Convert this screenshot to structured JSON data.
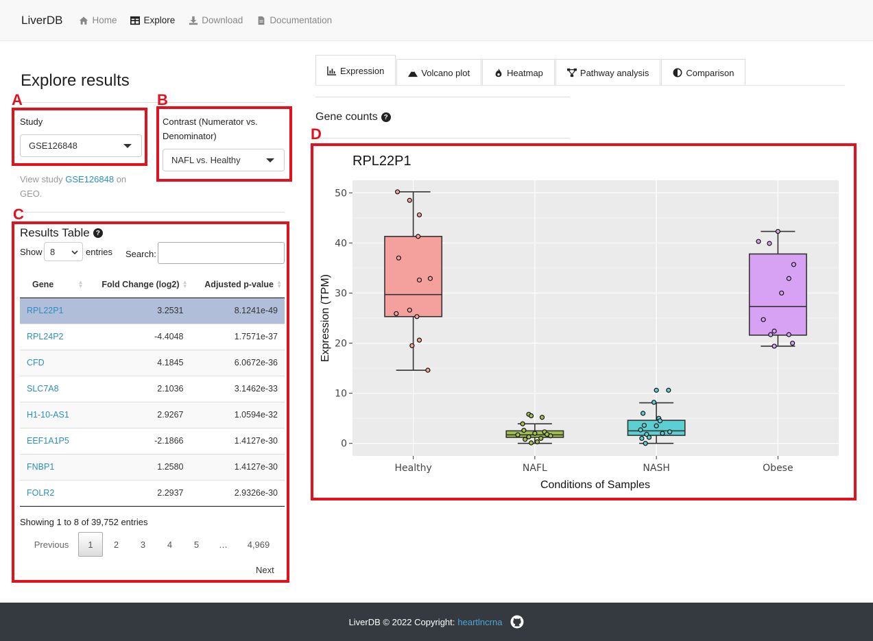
{
  "navbar": {
    "brand": "LiverDB",
    "items": [
      {
        "label": "Home",
        "icon": "home-icon"
      },
      {
        "label": "Explore",
        "icon": "table-icon"
      },
      {
        "label": "Download",
        "icon": "download-icon"
      },
      {
        "label": "Documentation",
        "icon": "file-icon"
      }
    ]
  },
  "annotations": [
    "A",
    "B",
    "C",
    "D"
  ],
  "sidebar": {
    "title": "Explore results",
    "study_label": "Study",
    "study_value": "GSE126848",
    "contrast_label": "Contrast (Numerator vs. Denominator)",
    "contrast_value": "NAFL vs. Healthy",
    "view_prefix": "View study ",
    "view_link": "GSE126848",
    "view_suffix": " on GEO."
  },
  "results": {
    "title": "Results Table",
    "show_label": "Show",
    "show_value": "8",
    "entries_label": "entries",
    "search_label": "Search:",
    "search_value": "",
    "columns": [
      "Gene",
      "Fold Change (log2)",
      "Adjusted p-value"
    ],
    "rows": [
      [
        "RPL22P1",
        "3.2531",
        "8.1241e-49"
      ],
      [
        "RPL24P2",
        "-4.4048",
        "1.7571e-37"
      ],
      [
        "CFD",
        "4.1845",
        "6.0672e-36"
      ],
      [
        "SLC7A8",
        "2.1036",
        "3.1462e-33"
      ],
      [
        "H1-10-AS1",
        "2.9267",
        "1.0594e-32"
      ],
      [
        "EEF1A1P5",
        "-2.1866",
        "1.4127e-30"
      ],
      [
        "FNBP1",
        "1.2580",
        "1.4127e-30"
      ],
      [
        "FOLR2",
        "2.2937",
        "2.9326e-30"
      ]
    ],
    "info": "Showing 1 to 8 of 39,752 entries",
    "pagination": [
      "Previous",
      "1",
      "2",
      "3",
      "4",
      "5",
      "…",
      "4,969"
    ],
    "next": "Next"
  },
  "tabs": [
    {
      "label": "Expression",
      "icon": "bar-chart-icon"
    },
    {
      "label": "Volcano plot",
      "icon": "mountain-icon"
    },
    {
      "label": "Heatmap",
      "icon": "fire-icon"
    },
    {
      "label": "Pathway analysis",
      "icon": "network-icon"
    },
    {
      "label": "Comparison",
      "icon": "half-circle-icon"
    }
  ],
  "gene_counts_title": "Gene counts",
  "chart_data": {
    "type": "box",
    "title": "RPL22P1",
    "xlabel": "Conditions of Samples",
    "ylabel": "Expression (TPM)",
    "ylim": [
      -2.5,
      52.5
    ],
    "yticks": [
      0,
      10,
      20,
      30,
      40,
      50
    ],
    "grid": true,
    "categories": [
      "Healthy",
      "NAFL",
      "NASH",
      "Obese"
    ],
    "colors": [
      "#f4a09c",
      "#a3c247",
      "#5ccfd2",
      "#d7a2f3"
    ],
    "boxes": [
      {
        "q1": 25.3,
        "median": 29.7,
        "q3": 41.3,
        "whisker_low": 14.6,
        "whisker_high": 50.2
      },
      {
        "q1": 1.2,
        "median": 1.7,
        "q3": 2.5,
        "whisker_low": 0.0,
        "whisker_high": 3.9
      },
      {
        "q1": 1.6,
        "median": 2.5,
        "q3": 4.6,
        "whisker_low": 0.0,
        "whisker_high": 8.1
      },
      {
        "q1": 21.6,
        "median": 27.3,
        "q3": 37.8,
        "whisker_low": 19.4,
        "whisker_high": 42.3
      }
    ],
    "points": [
      [
        [
          -0.13,
          50.2
        ],
        [
          -0.03,
          48.5
        ],
        [
          0.05,
          45.6
        ],
        [
          0.04,
          41.3
        ],
        [
          -0.12,
          37.0
        ],
        [
          0.14,
          32.9
        ],
        [
          0.05,
          32.6
        ],
        [
          -0.03,
          26.6
        ],
        [
          -0.14,
          25.9
        ],
        [
          0.03,
          25.3
        ],
        [
          0.05,
          20.6
        ],
        [
          -0.01,
          19.5
        ],
        [
          0.12,
          14.6
        ]
      ],
      [
        [
          -0.05,
          5.8
        ],
        [
          -0.03,
          5.5
        ],
        [
          0.06,
          5.2
        ],
        [
          -0.1,
          3.9
        ],
        [
          0.08,
          2.3
        ],
        [
          -0.09,
          2.6
        ],
        [
          -0.14,
          1.7
        ],
        [
          0.0,
          2.0
        ],
        [
          0.1,
          1.8
        ],
        [
          -0.05,
          1.3
        ],
        [
          0.13,
          1.5
        ],
        [
          0.05,
          1.0
        ],
        [
          -0.08,
          0.8
        ],
        [
          0.02,
          0.3
        ],
        [
          -0.03,
          0.1
        ]
      ],
      [
        [
          0.0,
          10.6
        ],
        [
          0.1,
          10.6
        ],
        [
          -0.02,
          8.2
        ],
        [
          -0.11,
          6.0
        ],
        [
          0.02,
          5.0
        ],
        [
          0.03,
          4.5
        ],
        [
          -0.1,
          3.6
        ],
        [
          0.0,
          3.5
        ],
        [
          -0.13,
          2.7
        ],
        [
          0.11,
          2.3
        ],
        [
          0.05,
          2.0
        ],
        [
          -0.08,
          1.8
        ],
        [
          -0.06,
          1.2
        ],
        [
          -0.12,
          1.0
        ],
        [
          -0.09,
          0.0
        ]
      ],
      [
        [
          0.0,
          42.3
        ],
        [
          -0.16,
          40.3
        ],
        [
          -0.07,
          39.9
        ],
        [
          0.13,
          35.7
        ],
        [
          0.09,
          32.9
        ],
        [
          0.03,
          30.0
        ],
        [
          -0.12,
          24.7
        ],
        [
          -0.03,
          22.4
        ],
        [
          -0.06,
          21.7
        ],
        [
          0.09,
          21.7
        ],
        [
          0.12,
          20.0
        ],
        [
          -0.03,
          19.4
        ]
      ]
    ]
  },
  "footer": {
    "text": "LiverDB © 2022 Copyright: ",
    "link": "heartlncrna"
  }
}
